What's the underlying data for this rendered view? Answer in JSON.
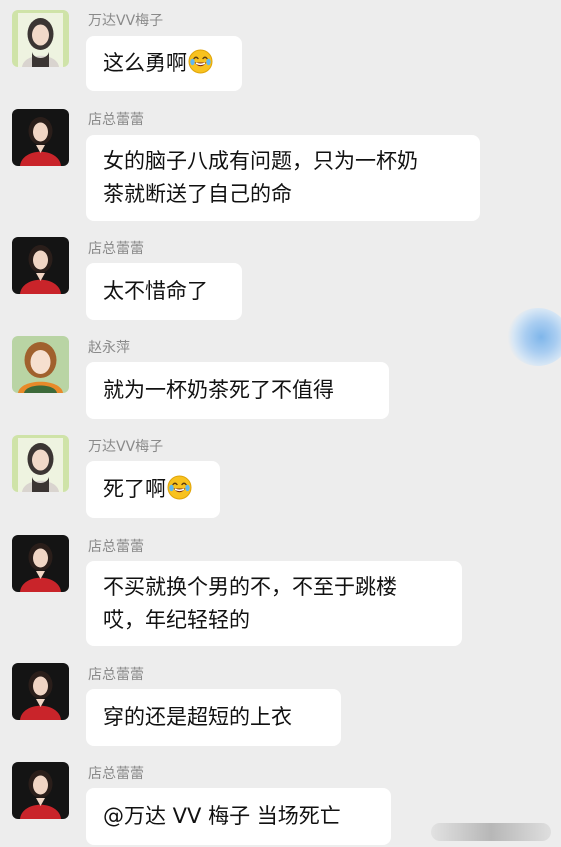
{
  "messages": [
    {
      "sender": "万达VV梅子",
      "avatar": "avatar-meizi-icon",
      "lines": [
        "这么勇啊"
      ],
      "emoji": "laughing-crying-emoji"
    },
    {
      "sender": "店总蕾蕾",
      "avatar": "avatar-leilei-icon",
      "lines": [
        "女的脑子八成有问题，只为一杯奶",
        "茶就断送了自己的命"
      ]
    },
    {
      "sender": "店总蕾蕾",
      "avatar": "avatar-leilei-icon",
      "lines": [
        "太不惜命了"
      ]
    },
    {
      "sender": "赵永萍",
      "avatar": "avatar-zhaoyongping-icon",
      "lines": [
        "就为一杯奶茶死了不值得"
      ]
    },
    {
      "sender": "万达VV梅子",
      "avatar": "avatar-meizi-icon",
      "lines": [
        "死了啊"
      ],
      "emoji": "laughing-crying-emoji"
    },
    {
      "sender": "店总蕾蕾",
      "avatar": "avatar-leilei-icon",
      "lines": [
        "不买就换个男的不，不至于跳楼",
        "哎，年纪轻轻的"
      ]
    },
    {
      "sender": "店总蕾蕾",
      "avatar": "avatar-leilei-icon",
      "lines": [
        "穿的还是超短的上衣"
      ]
    },
    {
      "sender": "店总蕾蕾",
      "avatar": "avatar-leilei-icon",
      "lines": [
        "@万达 VV 梅子  当场死亡"
      ]
    }
  ],
  "colors": {
    "background": "#ededed",
    "bubble": "#ffffff",
    "sender_name": "#8a8a8a",
    "text": "#111111"
  }
}
